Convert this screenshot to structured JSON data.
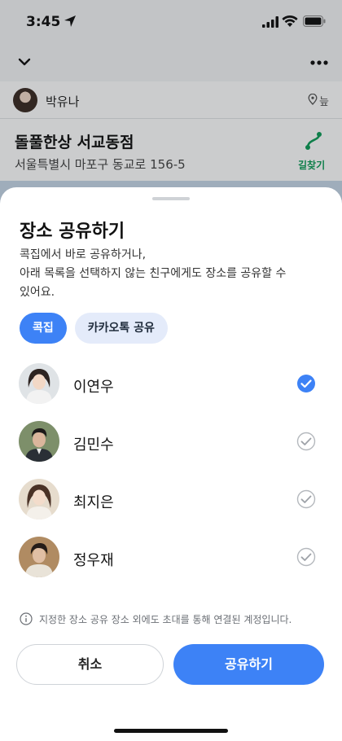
{
  "status_bar": {
    "time": "3:45"
  },
  "background": {
    "user": {
      "name": "박유나",
      "pin_label": "늪"
    },
    "place": {
      "title": "돌풀한상 서교동점",
      "address": "서울특별시 마포구 동교로 156-5",
      "route_label": "길찾기"
    }
  },
  "sheet": {
    "title": "장소 공유하기",
    "description": [
      "콕집에서 바로 공유하거나,",
      "아래 목록을 선택하지 않는 친구에게도 장소를 공유할 수",
      "있어요."
    ],
    "chips": [
      {
        "label": "콕집",
        "active": true
      },
      {
        "label": "카카오톡 공유",
        "active": false
      }
    ],
    "friends": [
      {
        "name": "이연우",
        "selected": true
      },
      {
        "name": "김민수",
        "selected": false
      },
      {
        "name": "최지은",
        "selected": false
      },
      {
        "name": "정우재",
        "selected": false
      }
    ],
    "notice": "지정한 장소 공유 장소 외에도 초대를 통해 연결된 계정입니다.",
    "cancel_label": "취소",
    "share_label": "공유하기"
  },
  "colors": {
    "accent": "#3d82f6",
    "route_green": "#0f9d58",
    "chip_inactive": "#e4ebfa"
  }
}
